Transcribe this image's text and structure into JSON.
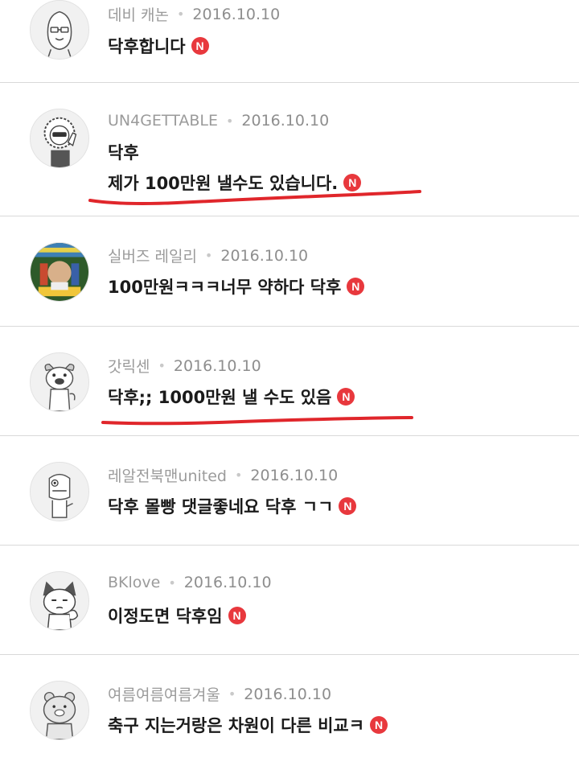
{
  "comments": [
    {
      "author": "데비 캐논",
      "date": "2016.10.10",
      "lines": [
        "닥후합니다"
      ],
      "new_badge": "N",
      "avatar_icon": "peach-character-icon"
    },
    {
      "author": "UN4GETTABLE",
      "date": "2016.10.10",
      "lines": [
        "닥후",
        "제가 100만원 낼수도 있습니다."
      ],
      "new_badge": "N",
      "avatar_icon": "curly-hair-character-icon"
    },
    {
      "author": "실버즈 레일리",
      "date": "2016.10.10",
      "lines": [
        "100만원ㅋㅋㅋ너무 약하다 닥후"
      ],
      "new_badge": "N",
      "avatar_icon": "manga-cover-photo-icon"
    },
    {
      "author": "갓릭센",
      "date": "2016.10.10",
      "lines": [
        "닥후;; 1000만원 낼 수도 있음"
      ],
      "new_badge": "N",
      "avatar_icon": "dog-character-icon"
    },
    {
      "author": "레알전북맨united",
      "date": "2016.10.10",
      "lines": [
        "닥후 몰빵 댓글좋네요 닥후 ㄱㄱ"
      ],
      "new_badge": "N",
      "avatar_icon": "crocodile-character-icon"
    },
    {
      "author": "BKlove",
      "date": "2016.10.10",
      "lines": [
        "이정도면 닥후임"
      ],
      "new_badge": "N",
      "avatar_icon": "cat-character-icon"
    },
    {
      "author": "여름여름여름겨울",
      "date": "2016.10.10",
      "lines": [
        "축구 지는거랑은 차원이 다른 비교ㅋ"
      ],
      "new_badge": "N",
      "avatar_icon": "lion-character-icon"
    }
  ],
  "meta_separator": "•",
  "colors": {
    "badge": "#e8383d",
    "underline": "#e0262b",
    "author": "#9b9b9b"
  }
}
